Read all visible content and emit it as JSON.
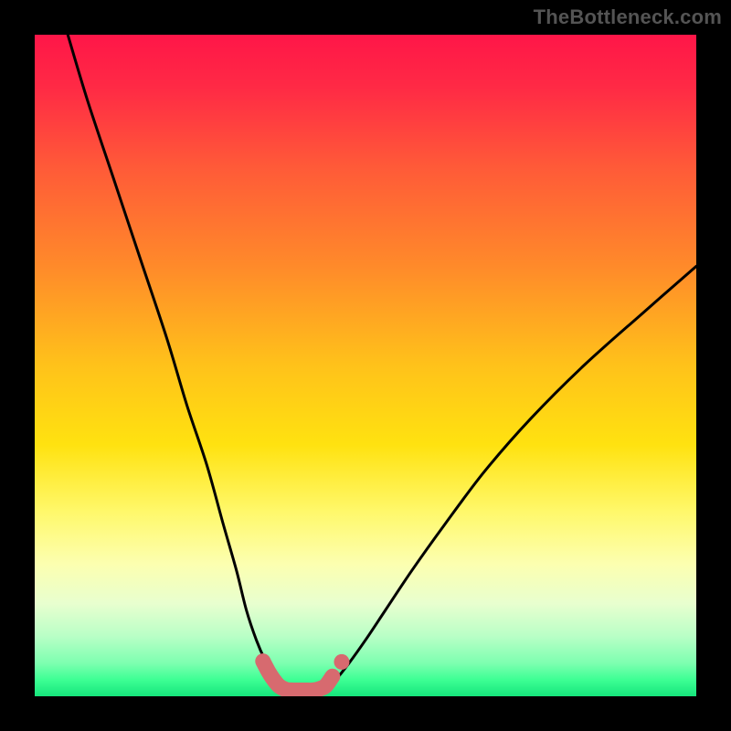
{
  "watermark": "TheBottleneck.com",
  "colors": {
    "frame": "#000000",
    "curve": "#000000",
    "marker_fill": "#d76a6f",
    "marker_stroke": "#d76a6f",
    "gradient_stops": [
      {
        "offset": 0.0,
        "color": "#ff1648"
      },
      {
        "offset": 0.08,
        "color": "#ff2a45"
      },
      {
        "offset": 0.2,
        "color": "#ff5a38"
      },
      {
        "offset": 0.35,
        "color": "#ff8a2a"
      },
      {
        "offset": 0.5,
        "color": "#ffc21a"
      },
      {
        "offset": 0.62,
        "color": "#ffe210"
      },
      {
        "offset": 0.72,
        "color": "#fff86a"
      },
      {
        "offset": 0.8,
        "color": "#fcffb0"
      },
      {
        "offset": 0.86,
        "color": "#e8ffcf"
      },
      {
        "offset": 0.91,
        "color": "#b8ffc6"
      },
      {
        "offset": 0.95,
        "color": "#7dffb0"
      },
      {
        "offset": 0.975,
        "color": "#3dff94"
      },
      {
        "offset": 1.0,
        "color": "#16e57c"
      }
    ]
  },
  "chart_data": {
    "type": "line",
    "title": "",
    "xlabel": "",
    "ylabel": "",
    "xlim": [
      0,
      100
    ],
    "ylim": [
      0,
      100
    ],
    "series": [
      {
        "name": "left-curve",
        "x": [
          5,
          8,
          12,
          16,
          20,
          23,
          26,
          28.5,
          30.5,
          32,
          33.5,
          34.8,
          36,
          37,
          37.8
        ],
        "y": [
          100,
          90,
          78,
          66,
          54,
          44,
          35,
          26,
          19,
          13,
          8.5,
          5.5,
          3.5,
          2,
          1.2
        ]
      },
      {
        "name": "right-curve",
        "x": [
          44,
          45.5,
          47.5,
          50,
          53,
          57,
          62,
          68,
          75,
          83,
          92,
          100
        ],
        "y": [
          1.2,
          2.5,
          5,
          8.5,
          13,
          19,
          26,
          34,
          42,
          50,
          58,
          65
        ]
      },
      {
        "name": "valley-markers",
        "x": [
          34.5,
          35.4,
          36.2,
          37,
          38,
          39,
          40,
          41,
          42,
          43,
          44,
          45
        ],
        "y": [
          5.3,
          3.6,
          2.4,
          1.5,
          1.0,
          0.9,
          0.9,
          0.9,
          0.9,
          1.1,
          1.6,
          3.0
        ]
      }
    ]
  }
}
